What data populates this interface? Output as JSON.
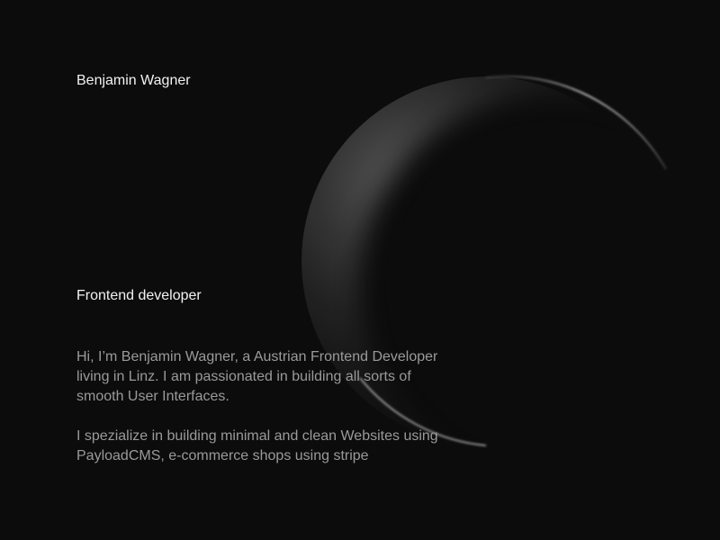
{
  "header": {
    "name": "Benjamin Wagner"
  },
  "hero": {
    "role": "Frontend developer",
    "bio_paragraph_1": "Hi, I’m Benjamin Wagner, a Austrian Frontend Developer living in Linz. I am passionated in building all sorts of smooth User Interfaces.",
    "bio_paragraph_2": "I spezialize in building minimal and clean Websites using PayloadCMS, e-commerce shops using stripe"
  },
  "colors": {
    "background": "#0c0c0c",
    "heading_text": "#f2f2f2",
    "body_text": "#9a9a9a"
  }
}
